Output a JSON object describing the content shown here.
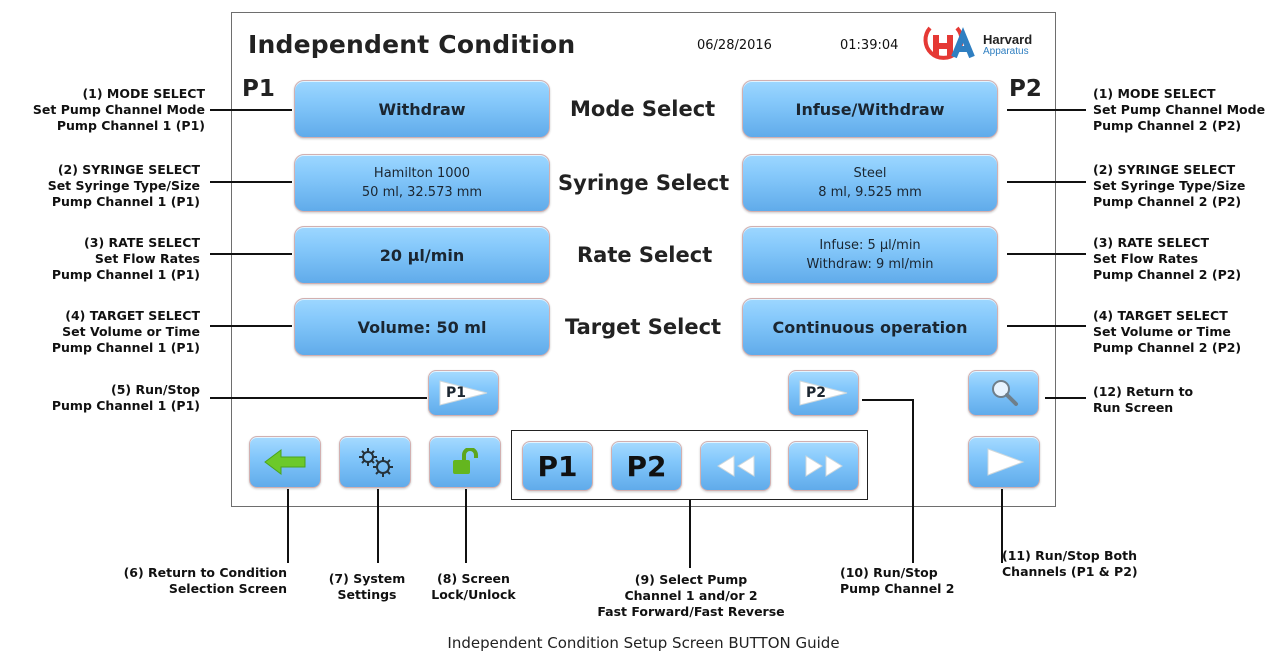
{
  "screen": {
    "title": "Independent Condition",
    "date": "06/28/2016",
    "time": "01:39:04",
    "logo_text": "Harvard",
    "logo_subtext": "Apparatus",
    "p1_label": "P1",
    "p2_label": "P2"
  },
  "buttons": {
    "mode_p1": "Withdraw",
    "mode_p2": "Infuse/Withdraw",
    "syringe_p1": [
      "Hamilton 1000",
      "50 ml, 32.573 mm"
    ],
    "syringe_p2": [
      "Steel",
      "8 ml, 9.525 mm"
    ],
    "rate_p1": "20 µl/min",
    "rate_p2": [
      "Infuse: 5 µl/min",
      "Withdraw: 9 ml/min"
    ],
    "target_p1": "Volume: 50 ml",
    "target_p2": "Continuous operation",
    "run_p1": "P1",
    "run_p2": "P2",
    "select_p1": "P1",
    "select_p2": "P2"
  },
  "center_labels": {
    "mode": "Mode Select",
    "syringe": "Syringe Select",
    "rate": "Rate Select",
    "target": "Target Select"
  },
  "annotations": {
    "left": [
      [
        "(1)  MODE SELECT",
        "Set Pump Channel Mode",
        "Pump Channel 1 (P1)"
      ],
      [
        "(2) SYRINGE SELECT",
        "Set Syringe Type/Size",
        "Pump Channel 1 (P1)"
      ],
      [
        "(3) RATE SELECT",
        "Set Flow Rates",
        "Pump Channel 1 (P1)"
      ],
      [
        "(4) TARGET SELECT",
        "Set Volume or Time",
        "Pump Channel 1 (P1)"
      ],
      [
        "(5) Run/Stop",
        "Pump Channel 1 (P1)"
      ]
    ],
    "right": [
      [
        "(1)  MODE SELECT",
        "Set Pump Channel Mode",
        "Pump Channel 2 (P2)"
      ],
      [
        "(2) SYRINGE SELECT",
        "Set Syringe Type/Size",
        "Pump Channel 2 (P2)"
      ],
      [
        "(3) RATE SELECT",
        "Set Flow Rates",
        "Pump Channel 2 (P2)"
      ],
      [
        "(4) TARGET SELECT",
        "Set Volume or Time",
        "Pump Channel 2 (P2)"
      ],
      [
        "(12) Return to",
        "Run Screen"
      ]
    ],
    "bottom": [
      [
        "(6) Return to Condition",
        "Selection Screen"
      ],
      [
        "(7) System",
        "Settings"
      ],
      [
        "(8) Screen",
        "Lock/Unlock"
      ],
      [
        "(9) Select Pump",
        "Channel 1 and/or 2",
        "Fast Forward/Fast Reverse"
      ],
      [
        "(10) Run/Stop",
        "Pump Channel 2"
      ],
      [
        "(11) Run/Stop Both",
        "Channels (P1 & P2)"
      ]
    ]
  },
  "caption": "Independent Condition Setup Screen BUTTON Guide",
  "colors": {
    "button": "#86c9fb",
    "button_border": "#d2b0b0",
    "logo_red": "#e53935",
    "logo_blue": "#2f7fc1",
    "arrow_green": "#66c61c"
  }
}
